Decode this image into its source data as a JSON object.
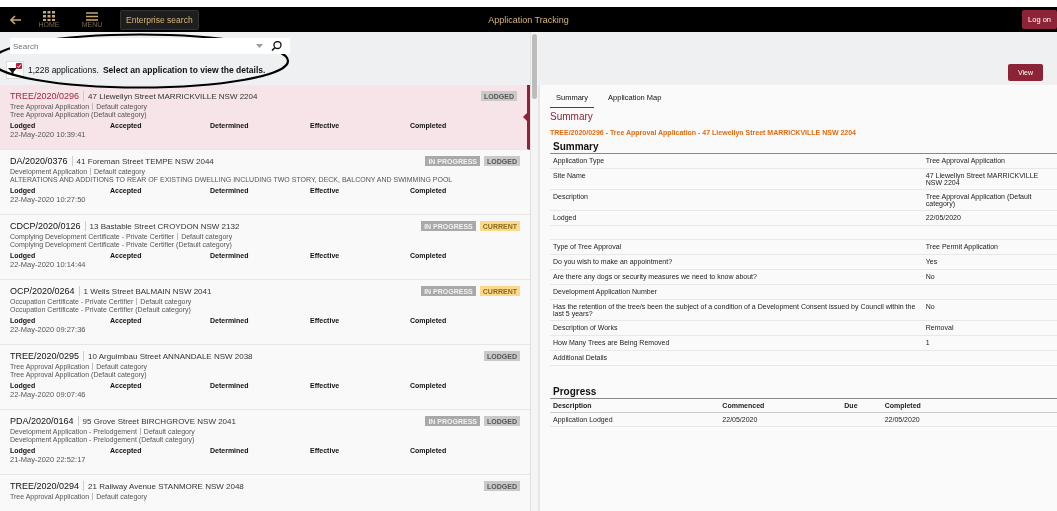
{
  "topbar": {
    "nav": [
      {
        "kind": "back"
      },
      {
        "kind": "home",
        "label": "HOME"
      },
      {
        "kind": "menu",
        "label": "MENU"
      }
    ],
    "enterprise_search": "Enterprise search",
    "title": "Application Tracking",
    "login": "Log on"
  },
  "list": {
    "search": {
      "placeholder": "Search"
    },
    "filter_active": true,
    "count": "1,228 applications.",
    "hint": "Select an application to view the details.",
    "rows": [
      {
        "id": "TREE/2020/0296",
        "address": "47 Llewellyn Street MARRICKVILLE NSW 2204",
        "type": "Tree Approval Application",
        "category": "Default category",
        "description": "Tree Approval Application (Default category)",
        "selected": true,
        "badges": [
          {
            "label": "LODGED",
            "kind": "lodged"
          }
        ],
        "dates": [
          {
            "label": "Lodged",
            "value": "22-May-2020 10:39:41"
          },
          {
            "label": "Accepted"
          },
          {
            "label": "Determined"
          },
          {
            "label": "Effective"
          },
          {
            "label": "Completed"
          }
        ]
      },
      {
        "id": "DA/2020/0376",
        "address": "41 Foreman Street TEMPE NSW 2044",
        "type": "Development Application",
        "category": "Default category",
        "description": "ALTERATIONS AND ADDITIONS TO REAR OF EXISTING DWELLING INCLUDING TWO STORY, DECK, BALCONY AND SWIMMING POOL",
        "selected": false,
        "badges": [
          {
            "label": "IN PROGRESS",
            "kind": "progress"
          },
          {
            "label": "LODGED",
            "kind": "lodged"
          }
        ],
        "dates": [
          {
            "label": "Lodged",
            "value": "22-May-2020 10:27:50"
          },
          {
            "label": "Accepted"
          },
          {
            "label": "Determined"
          },
          {
            "label": "Effective"
          },
          {
            "label": "Completed"
          }
        ]
      },
      {
        "id": "CDCP/2020/0126",
        "address": "13 Bastable Street CROYDON NSW 2132",
        "type": "Complying Development Certificate - Private Certifier",
        "category": "Default category",
        "description": "Complying Development Certificate - Private Certifier (Default category)",
        "selected": false,
        "badges": [
          {
            "label": "IN PROGRESS",
            "kind": "progress"
          },
          {
            "label": "CURRENT",
            "kind": "current"
          }
        ],
        "dates": [
          {
            "label": "Lodged",
            "value": "22-May-2020 10:14:44"
          },
          {
            "label": "Accepted"
          },
          {
            "label": "Determined"
          },
          {
            "label": "Effective"
          },
          {
            "label": "Completed"
          }
        ]
      },
      {
        "id": "OCP/2020/0264",
        "address": "1 Wells Street BALMAIN NSW 2041",
        "type": "Occupation Certificate - Private Certifier",
        "category": "Default category",
        "description": "Occupation Certificate - Private Certifier (Default category)",
        "selected": false,
        "badges": [
          {
            "label": "IN PROGRESS",
            "kind": "progress"
          },
          {
            "label": "CURRENT",
            "kind": "current"
          }
        ],
        "dates": [
          {
            "label": "Lodged",
            "value": "22-May-2020 09:27:36"
          },
          {
            "label": "Accepted"
          },
          {
            "label": "Determined"
          },
          {
            "label": "Effective"
          },
          {
            "label": "Completed"
          }
        ]
      },
      {
        "id": "TREE/2020/0295",
        "address": "10 Arguimbau Street ANNANDALE NSW 2038",
        "type": "Tree Approval Application",
        "category": "Default category",
        "description": "Tree Approval Application (Default category)",
        "selected": false,
        "badges": [
          {
            "label": "LODGED",
            "kind": "lodged"
          }
        ],
        "dates": [
          {
            "label": "Lodged",
            "value": "22-May-2020 09:07:46"
          },
          {
            "label": "Accepted"
          },
          {
            "label": "Determined"
          },
          {
            "label": "Effective"
          },
          {
            "label": "Completed"
          }
        ]
      },
      {
        "id": "PDA/2020/0164",
        "address": "95 Grove Street BIRCHGROVE NSW 2041",
        "type": "Development Application - Prelodgement",
        "category": "Default category",
        "description": "Development Application - Prelodgement (Default category)",
        "selected": false,
        "badges": [
          {
            "label": "IN PROGRESS",
            "kind": "progress"
          },
          {
            "label": "LODGED",
            "kind": "lodged"
          }
        ],
        "dates": [
          {
            "label": "Lodged",
            "value": "21-May-2020 22:52:17"
          },
          {
            "label": "Accepted"
          },
          {
            "label": "Determined"
          },
          {
            "label": "Effective"
          },
          {
            "label": "Completed"
          }
        ]
      },
      {
        "id": "TREE/2020/0294",
        "address": "21 Railway Avenue STANMORE NSW 2048",
        "type": "Tree Approval Application",
        "category": "Default category",
        "selected": false,
        "badges": [
          {
            "label": "LODGED",
            "kind": "lodged"
          }
        ]
      }
    ]
  },
  "detail": {
    "view_button": "View",
    "tabs": [
      {
        "label": "Summary",
        "selected": true
      },
      {
        "label": "Application Map",
        "selected": false
      }
    ],
    "heading": "Summary",
    "subtitle": "TREE/2020/0296 - Tree Approval Application - 47 Llewellyn Street MARRICKVILLE NSW 2204",
    "summary": {
      "title": "Summary",
      "groups": [
        [
          {
            "label": "Application Type",
            "value": "Tree Approval Application"
          },
          {
            "label": "Site Name",
            "value": "47 Llewellyn Street MARRICKVILLE NSW 2204"
          },
          {
            "label": "Description",
            "value": "Tree Approval Application (Default category)"
          },
          {
            "label": "Lodged",
            "value": "22/05/2020"
          }
        ],
        [
          {
            "label": "Type of Tree Approval",
            "value": "Tree Permit Application"
          },
          {
            "label": "Do you wish to make an appointment?",
            "value": "Yes"
          },
          {
            "label": "Are there any dogs or security measures we need to know about?",
            "value": "No"
          },
          {
            "label": "Development Application Number"
          },
          {
            "label": "Has the retention of the tree/s been the subject of a condition of a Development Consent issued by Council within the last 5 years?",
            "value": "No"
          },
          {
            "label": "Description of Works",
            "value": "Removal"
          },
          {
            "label": "How Many Trees are Being Removed",
            "value": "1"
          },
          {
            "label": "Additional Details"
          }
        ]
      ]
    },
    "progress": {
      "title": "Progress",
      "columns": [
        "Description",
        "Commenced",
        "Due",
        "Completed"
      ],
      "rows": [
        [
          "Application Lodged",
          "22/05/2020",
          "",
          "22/05/2020"
        ]
      ]
    }
  }
}
